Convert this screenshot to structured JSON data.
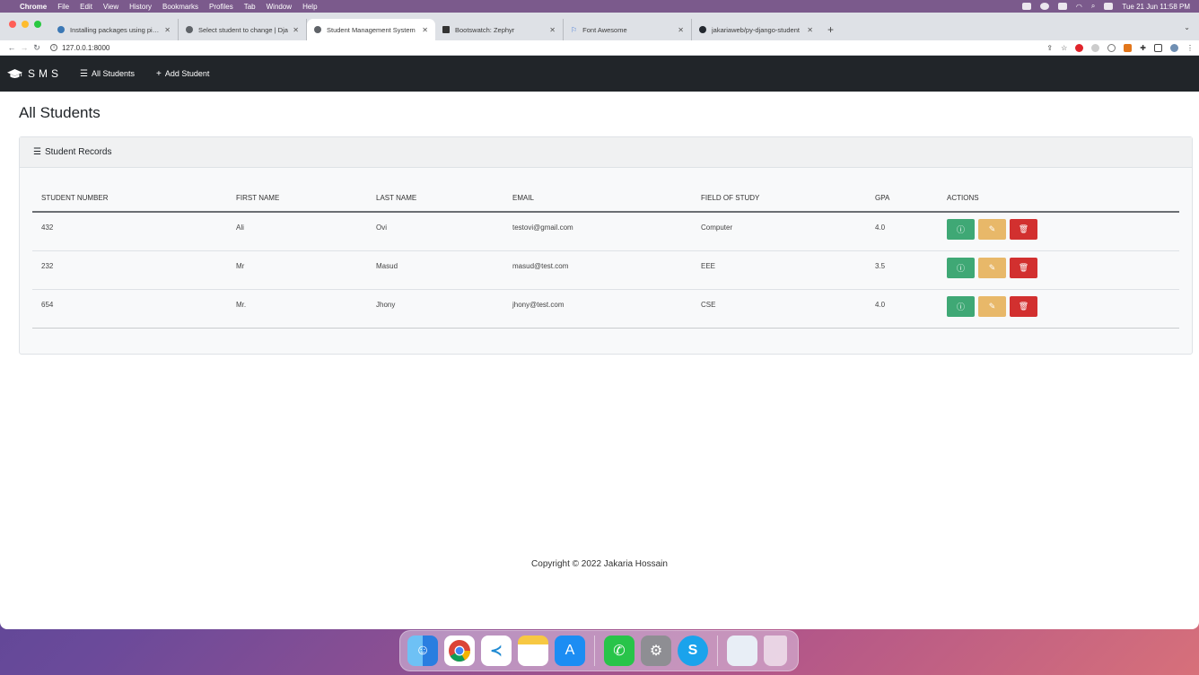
{
  "menubar": {
    "app_name": "Chrome",
    "menus": [
      "File",
      "Edit",
      "View",
      "History",
      "Bookmarks",
      "Profiles",
      "Tab",
      "Window",
      "Help"
    ],
    "datetime": "Tue 21 Jun  11:58 PM"
  },
  "browser": {
    "tabs": [
      {
        "title": "Installing packages using pip a",
        "icon": "python-icon",
        "active": false
      },
      {
        "title": "Select student to change | Dja",
        "icon": "globe-icon",
        "active": false
      },
      {
        "title": "Student Management System",
        "icon": "globe-icon",
        "active": true
      },
      {
        "title": "Bootswatch: Zephyr",
        "icon": "bootswatch-icon",
        "active": false
      },
      {
        "title": "Font Awesome",
        "icon": "flag-icon",
        "active": false
      },
      {
        "title": "jakariaweb/py-django-student",
        "icon": "github-icon",
        "active": false
      }
    ],
    "url": "127.0.0.1:8000"
  },
  "navbar": {
    "brand": "SMS",
    "links": [
      {
        "label": "All Students",
        "icon": "list-icon"
      },
      {
        "label": "Add Student",
        "icon": "plus-icon"
      }
    ]
  },
  "page": {
    "title": "All Students",
    "card_title": "Student Records"
  },
  "table": {
    "columns": [
      "STUDENT NUMBER",
      "FIRST NAME",
      "LAST NAME",
      "EMAIL",
      "FIELD OF STUDY",
      "GPA",
      "ACTIONS"
    ],
    "rows": [
      {
        "student_number": "432",
        "first_name": "Ali",
        "last_name": "Ovi",
        "email": "testovi@gmail.com",
        "field": "Computer",
        "gpa": "4.0"
      },
      {
        "student_number": "232",
        "first_name": "Mr",
        "last_name": "Masud",
        "email": "masud@test.com",
        "field": "EEE",
        "gpa": "3.5"
      },
      {
        "student_number": "654",
        "first_name": "Mr.",
        "last_name": "Jhony",
        "email": "jhony@test.com",
        "field": "CSE",
        "gpa": "4.0"
      }
    ]
  },
  "footer": {
    "text": "Copyright © 2022 Jakaria Hossain"
  },
  "colors": {
    "navbar_bg": "#212529",
    "info_button": "#3fa875",
    "edit_button": "#e8b869",
    "delete_button": "#d2302f"
  },
  "dock": {
    "apps": [
      "finder-icon",
      "chrome-icon",
      "vscode-icon",
      "notes-icon",
      "app-store-icon",
      "whatsapp-icon",
      "system-preferences-icon",
      "skype-icon",
      "preview-icon",
      "trash-icon"
    ]
  }
}
